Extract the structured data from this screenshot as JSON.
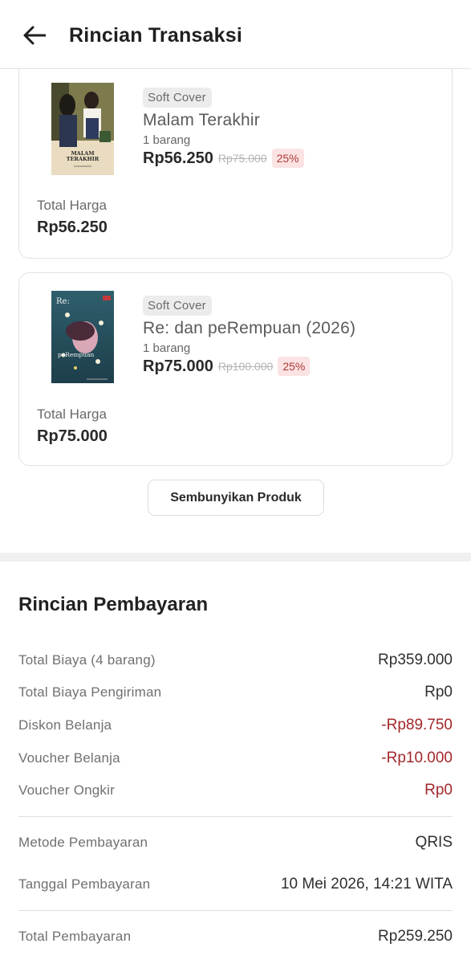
{
  "header": {
    "title": "Rincian Transaksi"
  },
  "products": [
    {
      "cover_title": "MALAM TERAKHIR",
      "variant": "Soft Cover",
      "name": "Malam Terakhir",
      "qty": "1 barang",
      "price": "Rp56.250",
      "old_price": "Rp75.000",
      "discount": "25%",
      "total_label": "Total Harga",
      "total_value": "Rp56.250"
    },
    {
      "cover_title": "Re:",
      "cover_subtitle": "peRempuan",
      "variant": "Soft Cover",
      "name": "Re: dan peRempuan (2026)",
      "qty": "1 barang",
      "price": "Rp75.000",
      "old_price": "Rp100.000",
      "discount": "25%",
      "total_label": "Total Harga",
      "total_value": "Rp75.000"
    }
  ],
  "hide_button": "Sembunyikan Produk",
  "payment": {
    "title": "Rincian Pembayaran",
    "rows": [
      {
        "label": "Total Biaya (4 barang)",
        "value": "Rp359.000"
      },
      {
        "label": "Total Biaya Pengiriman",
        "value": "Rp0"
      },
      {
        "label": "Diskon Belanja",
        "value": "-Rp89.750"
      },
      {
        "label": "Voucher Belanja",
        "value": "-Rp10.000"
      },
      {
        "label": "Voucher Ongkir",
        "value": "Rp0"
      }
    ],
    "method": {
      "label": "Metode Pembayaran",
      "value": "QRIS"
    },
    "date": {
      "label": "Tanggal Pembayaran",
      "value": "10 Mei 2026, 14:21 WITA"
    },
    "total": {
      "label": "Total Pembayaran",
      "value": "Rp259.250"
    }
  },
  "colors": {
    "negative": "#a3272b",
    "discount_badge_bg": "#fbe3e3",
    "discount_badge_text": "#b23838"
  }
}
